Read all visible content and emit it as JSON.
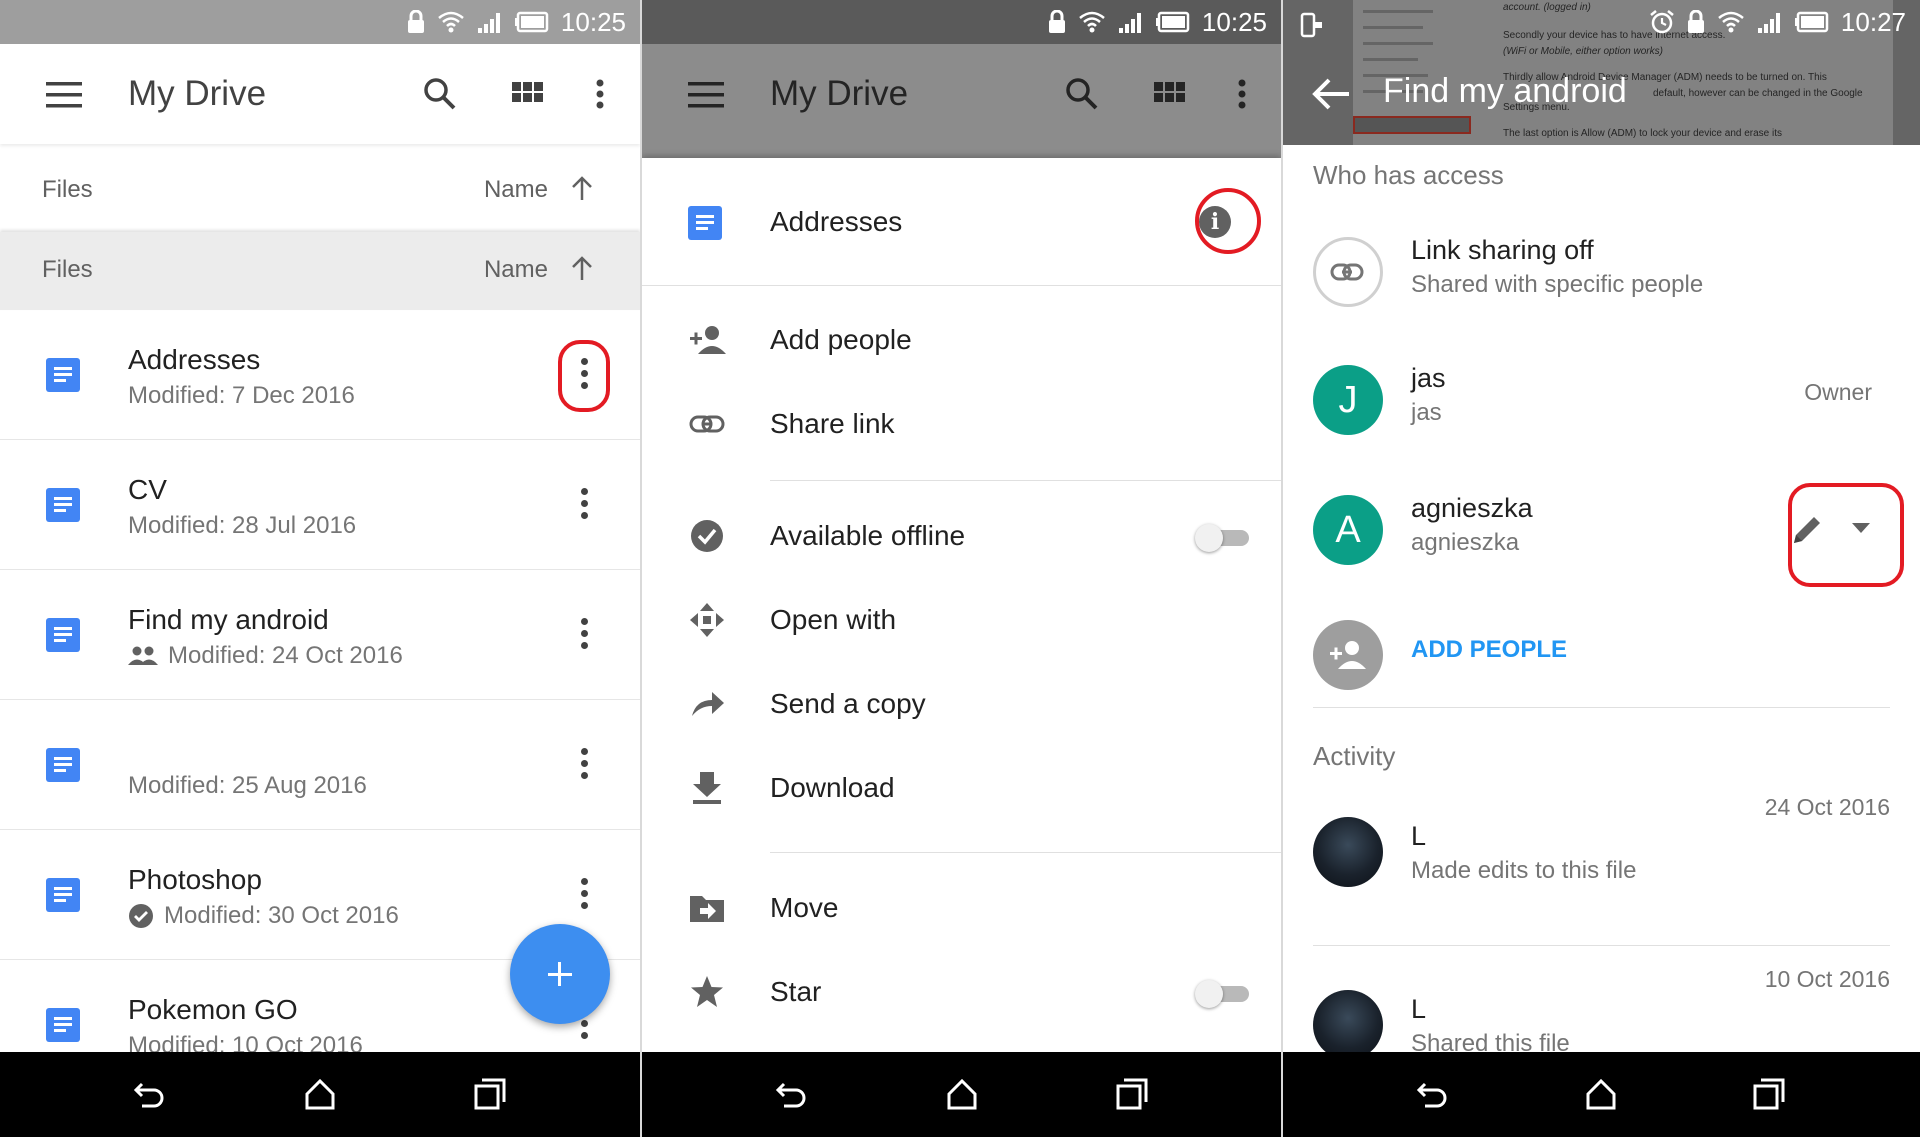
{
  "status": {
    "time1": "10:25",
    "time2": "10:25",
    "time3": "10:27"
  },
  "drive": {
    "title": "My Drive",
    "sort_section_label": "Files",
    "sort_by_label": "Name",
    "files": [
      {
        "name": "Addresses",
        "modified": "Modified: 7 Dec 2016"
      },
      {
        "name": "CV",
        "modified": "Modified: 28 Jul 2016"
      },
      {
        "name": "Find my android",
        "modified": "Modified: 24 Oct 2016"
      },
      {
        "name": "",
        "modified": "Modified: 25 Aug 2016"
      },
      {
        "name": "Photoshop",
        "modified": "Modified: 30 Oct 2016"
      },
      {
        "name": "Pokemon GO",
        "modified": "Modified: 10 Oct 2016"
      }
    ]
  },
  "sheet": {
    "file_name": "Addresses",
    "items": {
      "add_people": "Add people",
      "share_link": "Share link",
      "available_offline": "Available offline",
      "open_with": "Open with",
      "send_copy": "Send a copy",
      "download": "Download",
      "move": "Move",
      "star": "Star"
    },
    "available_offline_on": false,
    "star_on": false
  },
  "details": {
    "title": "Find my android",
    "bg_text": {
      "t1": "account. (logged in)",
      "t2": "Secondly your device has to have internet access.",
      "t3": "(WiFi or Mobile, either option works)",
      "t4": "Thirdly allow Android Device Manager (ADM) needs to be turned on. This",
      "t5": "default, however can be changed in the Google",
      "t6": "Settings menu.",
      "t7": "The last option is Allow (ADM) to lock your device and erase its"
    },
    "who_has_access": "Who has access",
    "link_sharing_title": "Link sharing off",
    "link_sharing_sub": "Shared with specific people",
    "people": [
      {
        "initial": "J",
        "name": "jas",
        "sub": "jas",
        "role": "Owner"
      },
      {
        "initial": "A",
        "name": "agnieszka",
        "sub": "agnieszka"
      }
    ],
    "add_people": "ADD PEOPLE",
    "activity_title": "Activity",
    "activity": [
      {
        "date": "24 Oct 2016",
        "user": "L",
        "action": "Made edits to this file"
      },
      {
        "date": "10 Oct 2016",
        "user": "L",
        "action": "Shared this file"
      }
    ],
    "colors": {
      "avatar": "#0b9f87",
      "accent": "#2196f3",
      "highlight": "#e31b23"
    }
  }
}
